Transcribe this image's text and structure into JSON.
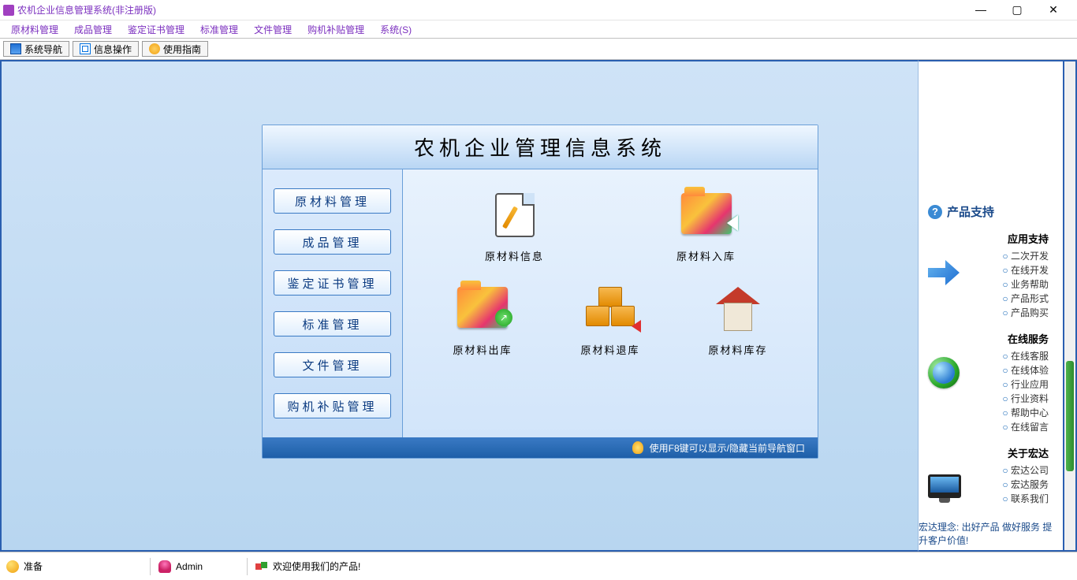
{
  "titlebar": {
    "title": "农机企业信息管理系统(非注册版)"
  },
  "menubar": [
    "原材料管理",
    "成品管理",
    "鉴定证书管理",
    "标准管理",
    "文件管理",
    "购机补贴管理",
    "系统(S)"
  ],
  "toolbar": [
    {
      "id": "nav",
      "label": "系统导航"
    },
    {
      "id": "info",
      "label": "信息操作"
    },
    {
      "id": "help",
      "label": "使用指南"
    }
  ],
  "panel": {
    "title": "农机企业管理信息系统",
    "nav_buttons": [
      "原材料管理",
      "成品管理",
      "鉴定证书管理",
      "标准管理",
      "文件管理",
      "购机补贴管理"
    ],
    "grid_row1": [
      {
        "id": "raw-info",
        "label": "原材料信息",
        "icon": "file-edit"
      },
      {
        "id": "raw-in",
        "label": "原材料入库",
        "icon": "folder-in"
      }
    ],
    "grid_row2": [
      {
        "id": "raw-out",
        "label": "原材料出库",
        "icon": "folder-out"
      },
      {
        "id": "raw-return",
        "label": "原材料退库",
        "icon": "boxes"
      },
      {
        "id": "raw-stock",
        "label": "原材料库存",
        "icon": "house"
      }
    ],
    "hint": "使用F8键可以显示/隐藏当前导航窗口"
  },
  "support": {
    "title": "产品支持",
    "sections": [
      {
        "head": "应用支持",
        "icon": "arrow",
        "links": [
          "二次开发",
          "在线开发",
          "业务帮助",
          "产品形式",
          "产品购买"
        ]
      },
      {
        "head": "在线服务",
        "icon": "globe",
        "links": [
          "在线客服",
          "在线体验",
          "行业应用",
          "行业资料",
          "帮助中心",
          "在线留言"
        ]
      },
      {
        "head": "关于宏达",
        "icon": "monitor",
        "links": [
          "宏达公司",
          "宏达服务",
          "联系我们"
        ]
      }
    ],
    "slogan": "宏达理念: 出好产品  做好服务  提升客户价值!"
  },
  "statusbar": {
    "ready": "准备",
    "user": "Admin",
    "welcome": "欢迎使用我们的产品!"
  }
}
